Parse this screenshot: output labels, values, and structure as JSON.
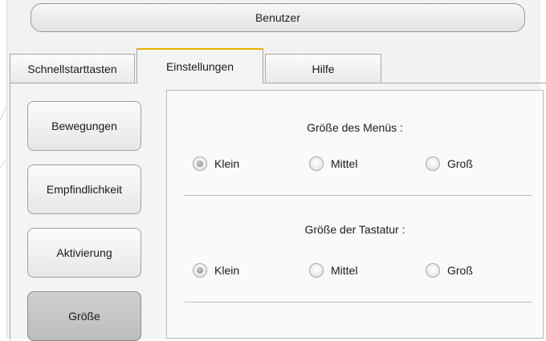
{
  "header": {
    "user_button_label": "Benutzer"
  },
  "tabs": [
    {
      "label": "Schnellstarttasten",
      "active": false
    },
    {
      "label": "Einstellungen",
      "active": true
    },
    {
      "label": "Hilfe",
      "active": false
    }
  ],
  "sidebar": {
    "items": [
      {
        "label": "Bewegungen",
        "active": false
      },
      {
        "label": "Empfindlichkeit",
        "active": false
      },
      {
        "label": "Aktivierung",
        "active": false
      },
      {
        "label": "Größe",
        "active": true
      }
    ]
  },
  "settings": {
    "menu_size": {
      "title": "Größe des Menüs :",
      "options": [
        "Klein",
        "Mittel",
        "Groß"
      ],
      "selected": "Klein"
    },
    "keyboard_size": {
      "title": "Größe der Tastatur :",
      "options": [
        "Klein",
        "Mittel",
        "Groß"
      ],
      "selected": "Klein"
    }
  },
  "colors": {
    "active_tab_accent": "#e8b100",
    "background": "#f2f2f2"
  }
}
